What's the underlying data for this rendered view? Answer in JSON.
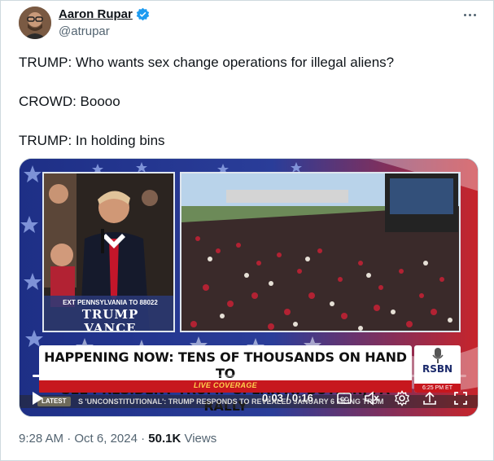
{
  "author": {
    "display_name": "Aaron Rupar",
    "handle": "@atrupar",
    "verified": true,
    "avatar_icon": "person-avatar"
  },
  "menu_icon": "more-horizontal-icon",
  "tweet": {
    "lines": [
      "TRUMP: Who wants sex change operations for illegal aliens?",
      "CROWD: Boooo",
      "TRUMP: In holding bins"
    ]
  },
  "video": {
    "left_banner_top": "EXT PENNSYLVANIA TO 88022",
    "left_banner_name1": "TRUMP",
    "left_banner_name2": "VANCE",
    "headline_line1": "HAPPENING NOW: TENS OF THOUSANDS ON HAND TO",
    "headline_line2": "SEE PRESIDENT TRUMP SPEAK AT BUTLER, PA RALLY",
    "live_label": "LIVE COVERAGE",
    "network": "RSBN",
    "network_time": "6:25 PM ET",
    "ticker_badge": "LATEST",
    "ticker_text": "S   'UNCONSTITUTIONAL': TRUMP RESPONDS TO REVEALED JANUARY 6 FILING   TRUM",
    "time_display": "0:03 / 0:16",
    "progress": 0.1875,
    "controls": {
      "play": "play-icon",
      "captions": "captions-icon",
      "volume": "volume-muted-icon",
      "settings": "gear-icon",
      "fullscreen": "fullscreen-icon"
    }
  },
  "meta": {
    "time": "9:28 AM",
    "date": "Oct 6, 2024",
    "separator": " · ",
    "views_count": "50.1K",
    "views_label": " Views"
  },
  "colors": {
    "verified_blue": "#1d9bf0",
    "secondary_text": "#536471",
    "rsbn_red": "#c7171e"
  }
}
